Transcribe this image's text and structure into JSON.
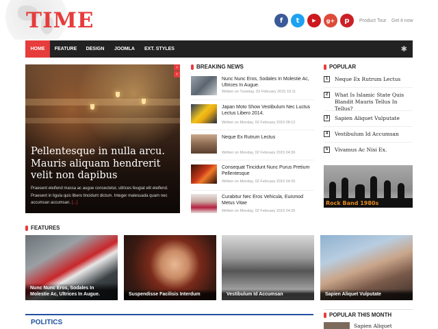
{
  "header": {
    "logo": "TIME",
    "links": [
      "Product Tour",
      "Get it now"
    ],
    "social": [
      {
        "name": "facebook-icon",
        "glyph": "f",
        "color": "#3b5998"
      },
      {
        "name": "twitter-icon",
        "glyph": "t",
        "color": "#1da1f2"
      },
      {
        "name": "youtube-icon",
        "glyph": "▶",
        "color": "#cc181e"
      },
      {
        "name": "google-plus-icon",
        "glyph": "g+",
        "color": "#dd4b39"
      },
      {
        "name": "pinterest-icon",
        "glyph": "p",
        "color": "#cb2027"
      }
    ]
  },
  "nav": {
    "items": [
      "HOME",
      "FEATURE",
      "DESIGN",
      "JOOMLA",
      "EXT. STYLES"
    ],
    "active_index": 0,
    "accent": "#e63c3c",
    "search_icon": "asterisk-icon"
  },
  "hero": {
    "title": "Pellentesque in nulla arcu. Mauris aliquam hendrerit velit non dapibus",
    "text": "Praesent eleifend massa ac augue consectetur, ultrices feugiat elit eleifend. Praesent in ligula quis libero tincidunt dictum. Integer malesuada quam nec accumsan accumsan.",
    "more": "[...]"
  },
  "breaking_news": {
    "title": "BREAKING NEWS",
    "items": [
      {
        "title": "Nunc Nunc Eros, Sodales In Molestie Ac, Ultrices In Augue.",
        "date": "Written on Tuesday, 03 February 2015 10:11"
      },
      {
        "title": "Japan Moto Show Vestibulum Nec Luctus Lectus Libero 2014.",
        "date": "Written on Monday, 02 February 2015 08:12"
      },
      {
        "title": "Neque Ex Rutrum Lectus",
        "date": "Written on Monday, 02 February 2015 04:36"
      },
      {
        "title": "Consequat Tincidunt Nunc Purus Pretium Pellentesque",
        "date": "Written on Monday, 02 February 2015 04:35"
      },
      {
        "title": "Curabitur Nec Eros Vehicula, Euismod Metus Vitae",
        "date": "Written on Monday, 02 February 2015 04:35"
      }
    ]
  },
  "popular": {
    "title": "POPULAR",
    "items": [
      {
        "num": "1",
        "title": "Neque Ex Rutrum Lectus"
      },
      {
        "num": "2",
        "title": "What Is Islamic State Quis Blandit Mauris Tellus In Tellus?"
      },
      {
        "num": "3",
        "title": "Sapien Aliquet Vulputate"
      },
      {
        "num": "4",
        "title": "Vestibulum Id Accumsan"
      },
      {
        "num": "5",
        "title": "Vivamus Ac Nisi Ex."
      }
    ],
    "banner": "Rock Band 1980s"
  },
  "features": {
    "title": "FEATURES",
    "items": [
      "Nunc Nunc Eros, Sodales In Molestie Ac, Ultrices In Augue.",
      "Suspendisse Facilisis Interdum",
      "Vestibulum Id Accumsan",
      "Sapien Aliquet Vulputate"
    ]
  },
  "politics": {
    "title": "POLITICS"
  },
  "popular_month": {
    "title": "POPULAR THIS MONTH",
    "first_item": "Sapien Aliquet"
  }
}
